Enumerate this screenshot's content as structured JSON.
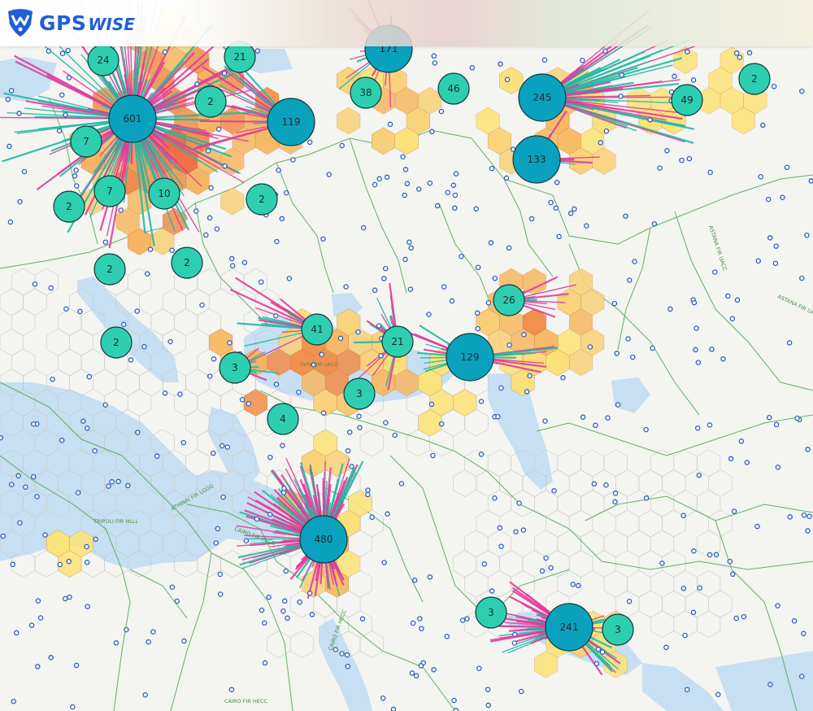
{
  "app": {
    "brand_main": "GPS",
    "brand_sub": "WISE"
  },
  "colors": {
    "cluster_small": "#2ecfb1",
    "cluster_large": "#0aa1bf",
    "line_pink": "#e03c9c",
    "line_teal": "#21b9a4",
    "hex_red": "#ec5840",
    "hex_orange": "#f0904c",
    "hex_yellow": "#fbe37a",
    "water": "#c6dff2",
    "border": "#49a649",
    "airport": "#2f5fb3"
  },
  "clusters": [
    {
      "id": "c601",
      "count": "601",
      "size": "large"
    },
    {
      "id": "c480",
      "count": "480",
      "size": "large"
    },
    {
      "id": "c245",
      "count": "245",
      "size": "large"
    },
    {
      "id": "c241",
      "count": "241",
      "size": "large"
    },
    {
      "id": "c171",
      "count": "171",
      "size": "large"
    },
    {
      "id": "c133",
      "count": "133",
      "size": "large"
    },
    {
      "id": "c129",
      "count": "129",
      "size": "large"
    },
    {
      "id": "c119",
      "count": "119",
      "size": "large"
    },
    {
      "id": "c49",
      "count": "49",
      "size": "small"
    },
    {
      "id": "c46",
      "count": "46",
      "size": "small"
    },
    {
      "id": "c41",
      "count": "41",
      "size": "small"
    },
    {
      "id": "c38",
      "count": "38",
      "size": "small"
    },
    {
      "id": "c26",
      "count": "26",
      "size": "small"
    },
    {
      "id": "c24",
      "count": "24",
      "size": "small"
    },
    {
      "id": "c21a",
      "count": "21",
      "size": "small"
    },
    {
      "id": "c21b",
      "count": "21",
      "size": "small"
    },
    {
      "id": "c10",
      "count": "10",
      "size": "small"
    },
    {
      "id": "c7a",
      "count": "7",
      "size": "small"
    },
    {
      "id": "c7b",
      "count": "7",
      "size": "small"
    },
    {
      "id": "c4",
      "count": "4",
      "size": "small"
    },
    {
      "id": "c3a",
      "count": "3",
      "size": "small"
    },
    {
      "id": "c3b",
      "count": "3",
      "size": "small"
    },
    {
      "id": "c3c",
      "count": "3",
      "size": "small"
    },
    {
      "id": "c3d",
      "count": "3",
      "size": "small"
    },
    {
      "id": "c2a",
      "count": "2",
      "size": "small"
    },
    {
      "id": "c2b",
      "count": "2",
      "size": "small"
    },
    {
      "id": "c2c",
      "count": "2",
      "size": "small"
    },
    {
      "id": "c2d",
      "count": "2",
      "size": "small"
    },
    {
      "id": "c2e",
      "count": "2",
      "size": "small"
    },
    {
      "id": "c2f",
      "count": "2",
      "size": "small"
    },
    {
      "id": "c2g",
      "count": "2",
      "size": "small"
    }
  ],
  "fir_labels": [
    {
      "id": "tripoli",
      "text": "TRIPOLI FIR HLLL"
    },
    {
      "id": "athinai",
      "text": "ATHINAI FIR LGGG"
    },
    {
      "id": "cairo1",
      "text": "CAIRO FIR HECC"
    },
    {
      "id": "cairo2",
      "text": "CAIRO FIR HECC"
    },
    {
      "id": "cairo3",
      "text": "CAIRO FIR HECC"
    },
    {
      "id": "astana",
      "text": "ASTANA FIR UACC"
    },
    {
      "id": "astana2",
      "text": "ASTANA FIR UA"
    },
    {
      "id": "lviv",
      "text": "LVIV UIR UKLU"
    }
  ]
}
